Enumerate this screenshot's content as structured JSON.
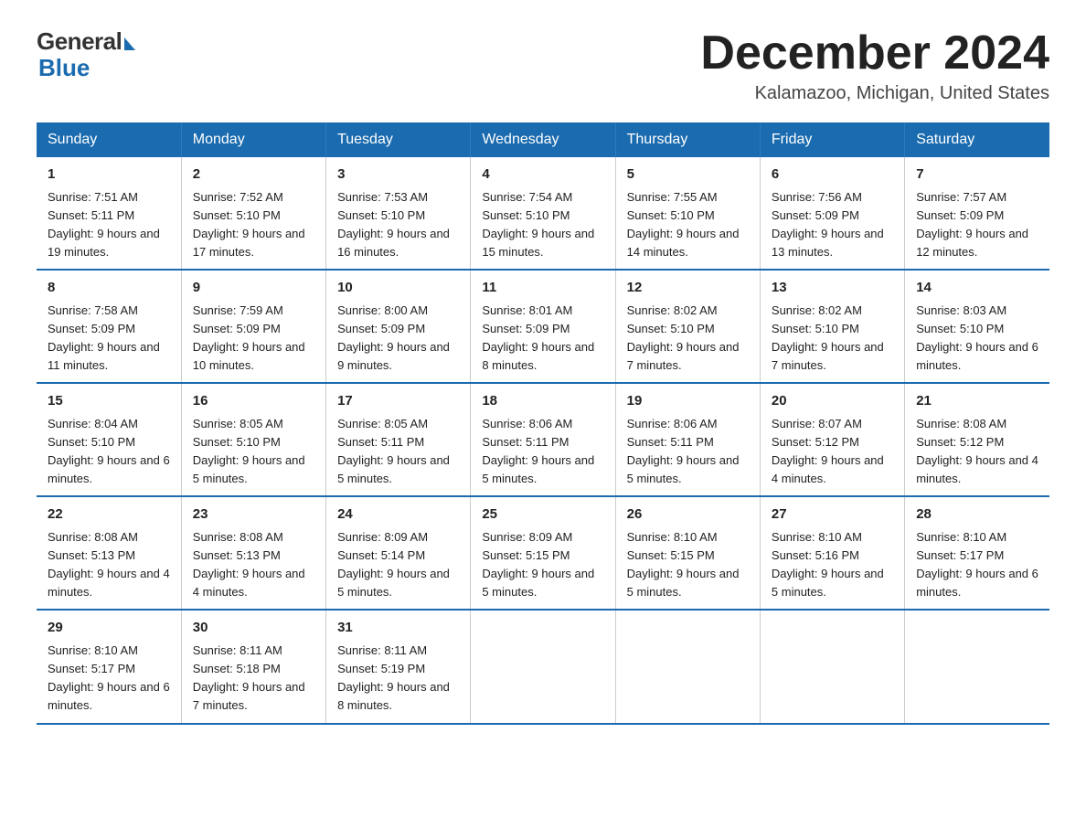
{
  "logo": {
    "general": "General",
    "blue": "Blue"
  },
  "title": "December 2024",
  "subtitle": "Kalamazoo, Michigan, United States",
  "days_of_week": [
    "Sunday",
    "Monday",
    "Tuesday",
    "Wednesday",
    "Thursday",
    "Friday",
    "Saturday"
  ],
  "weeks": [
    [
      {
        "day": "1",
        "sunrise": "7:51 AM",
        "sunset": "5:11 PM",
        "daylight": "9 hours and 19 minutes."
      },
      {
        "day": "2",
        "sunrise": "7:52 AM",
        "sunset": "5:10 PM",
        "daylight": "9 hours and 17 minutes."
      },
      {
        "day": "3",
        "sunrise": "7:53 AM",
        "sunset": "5:10 PM",
        "daylight": "9 hours and 16 minutes."
      },
      {
        "day": "4",
        "sunrise": "7:54 AM",
        "sunset": "5:10 PM",
        "daylight": "9 hours and 15 minutes."
      },
      {
        "day": "5",
        "sunrise": "7:55 AM",
        "sunset": "5:10 PM",
        "daylight": "9 hours and 14 minutes."
      },
      {
        "day": "6",
        "sunrise": "7:56 AM",
        "sunset": "5:09 PM",
        "daylight": "9 hours and 13 minutes."
      },
      {
        "day": "7",
        "sunrise": "7:57 AM",
        "sunset": "5:09 PM",
        "daylight": "9 hours and 12 minutes."
      }
    ],
    [
      {
        "day": "8",
        "sunrise": "7:58 AM",
        "sunset": "5:09 PM",
        "daylight": "9 hours and 11 minutes."
      },
      {
        "day": "9",
        "sunrise": "7:59 AM",
        "sunset": "5:09 PM",
        "daylight": "9 hours and 10 minutes."
      },
      {
        "day": "10",
        "sunrise": "8:00 AM",
        "sunset": "5:09 PM",
        "daylight": "9 hours and 9 minutes."
      },
      {
        "day": "11",
        "sunrise": "8:01 AM",
        "sunset": "5:09 PM",
        "daylight": "9 hours and 8 minutes."
      },
      {
        "day": "12",
        "sunrise": "8:02 AM",
        "sunset": "5:10 PM",
        "daylight": "9 hours and 7 minutes."
      },
      {
        "day": "13",
        "sunrise": "8:02 AM",
        "sunset": "5:10 PM",
        "daylight": "9 hours and 7 minutes."
      },
      {
        "day": "14",
        "sunrise": "8:03 AM",
        "sunset": "5:10 PM",
        "daylight": "9 hours and 6 minutes."
      }
    ],
    [
      {
        "day": "15",
        "sunrise": "8:04 AM",
        "sunset": "5:10 PM",
        "daylight": "9 hours and 6 minutes."
      },
      {
        "day": "16",
        "sunrise": "8:05 AM",
        "sunset": "5:10 PM",
        "daylight": "9 hours and 5 minutes."
      },
      {
        "day": "17",
        "sunrise": "8:05 AM",
        "sunset": "5:11 PM",
        "daylight": "9 hours and 5 minutes."
      },
      {
        "day": "18",
        "sunrise": "8:06 AM",
        "sunset": "5:11 PM",
        "daylight": "9 hours and 5 minutes."
      },
      {
        "day": "19",
        "sunrise": "8:06 AM",
        "sunset": "5:11 PM",
        "daylight": "9 hours and 5 minutes."
      },
      {
        "day": "20",
        "sunrise": "8:07 AM",
        "sunset": "5:12 PM",
        "daylight": "9 hours and 4 minutes."
      },
      {
        "day": "21",
        "sunrise": "8:08 AM",
        "sunset": "5:12 PM",
        "daylight": "9 hours and 4 minutes."
      }
    ],
    [
      {
        "day": "22",
        "sunrise": "8:08 AM",
        "sunset": "5:13 PM",
        "daylight": "9 hours and 4 minutes."
      },
      {
        "day": "23",
        "sunrise": "8:08 AM",
        "sunset": "5:13 PM",
        "daylight": "9 hours and 4 minutes."
      },
      {
        "day": "24",
        "sunrise": "8:09 AM",
        "sunset": "5:14 PM",
        "daylight": "9 hours and 5 minutes."
      },
      {
        "day": "25",
        "sunrise": "8:09 AM",
        "sunset": "5:15 PM",
        "daylight": "9 hours and 5 minutes."
      },
      {
        "day": "26",
        "sunrise": "8:10 AM",
        "sunset": "5:15 PM",
        "daylight": "9 hours and 5 minutes."
      },
      {
        "day": "27",
        "sunrise": "8:10 AM",
        "sunset": "5:16 PM",
        "daylight": "9 hours and 5 minutes."
      },
      {
        "day": "28",
        "sunrise": "8:10 AM",
        "sunset": "5:17 PM",
        "daylight": "9 hours and 6 minutes."
      }
    ],
    [
      {
        "day": "29",
        "sunrise": "8:10 AM",
        "sunset": "5:17 PM",
        "daylight": "9 hours and 6 minutes."
      },
      {
        "day": "30",
        "sunrise": "8:11 AM",
        "sunset": "5:18 PM",
        "daylight": "9 hours and 7 minutes."
      },
      {
        "day": "31",
        "sunrise": "8:11 AM",
        "sunset": "5:19 PM",
        "daylight": "9 hours and 8 minutes."
      },
      null,
      null,
      null,
      null
    ]
  ]
}
